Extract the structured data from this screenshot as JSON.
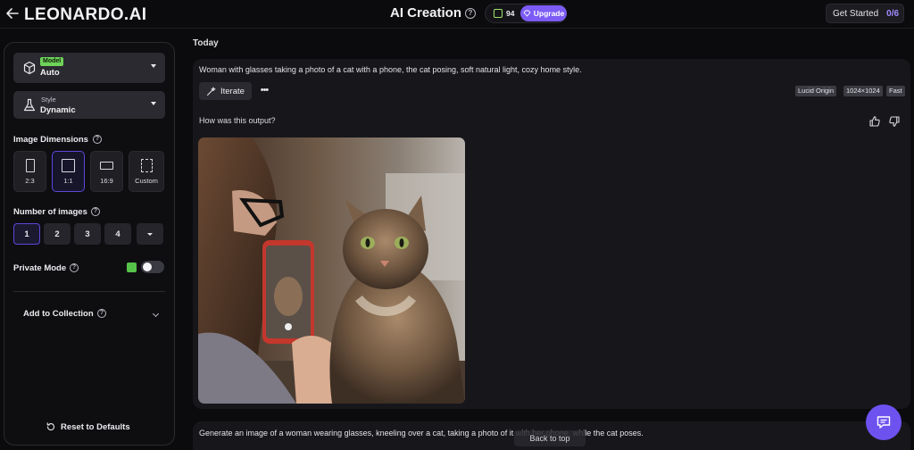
{
  "header": {
    "logo": "LEONARDO.AI",
    "title": "AI Creation",
    "tokens": "94",
    "upgrade_label": "Upgrade",
    "get_started_label": "Get Started",
    "get_started_progress": "0/6"
  },
  "sidebar": {
    "model": {
      "tag": "Model",
      "value": "Auto"
    },
    "style": {
      "label": "Style",
      "value": "Dynamic"
    },
    "image_dimensions_label": "Image Dimensions",
    "dimensions": [
      {
        "label": "2:3",
        "active": false
      },
      {
        "label": "1:1",
        "active": true
      },
      {
        "label": "16:9",
        "active": false
      },
      {
        "label": "Custom",
        "active": false
      }
    ],
    "number_of_images_label": "Number of images",
    "number_options": [
      "1",
      "2",
      "3",
      "4"
    ],
    "number_selected": "1",
    "private_mode_label": "Private Mode",
    "private_mode_on": false,
    "add_to_collection_label": "Add to Collection",
    "reset_label": "Reset to Defaults"
  },
  "main": {
    "section_label": "Today",
    "generations": [
      {
        "prompt": "Woman with glasses taking a photo of a cat with a phone, the cat posing, soft natural light, cozy home style.",
        "iterate_label": "Iterate",
        "tags": [
          "Lucid Origin",
          "1024×1024",
          "Fast"
        ],
        "feedback_question": "How was this output?"
      },
      {
        "prompt": "Generate an image of a woman wearing glasses, kneeling over a cat, taking a photo of it with her phone, while the cat poses."
      }
    ],
    "back_to_top_label": "Back to top"
  },
  "colors": {
    "accent": "#7c5cf5",
    "background": "#0b0b0d",
    "card": "#17171b",
    "private_badge": "#57c24a"
  }
}
